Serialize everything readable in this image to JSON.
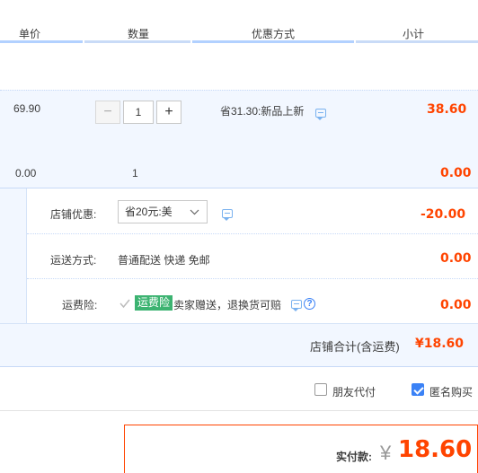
{
  "header": {
    "col_price": "单价",
    "col_quantity": "数量",
    "col_discount": "优惠方式",
    "col_subtotal": "小计"
  },
  "item": {
    "unit_price": "69.90",
    "quantity": "1",
    "discount_text": "省31.30:新品上新",
    "subtotal": "38.60",
    "decrement_symbol": "−",
    "increment_symbol": "+"
  },
  "extra_row": {
    "price": "0.00",
    "quantity": "1",
    "subtotal": "0.00"
  },
  "shop_discount": {
    "label": "店铺优惠:",
    "selected": "省20元:美",
    "amount": "-20.00"
  },
  "shipping": {
    "label": "运送方式:",
    "value": "普通配送 快递 免邮",
    "amount": "0.00"
  },
  "insurance": {
    "label": "运费险:",
    "badge": "运费险",
    "text": "卖家赠送，退换货可赔",
    "amount": "0.00",
    "help_symbol": "?"
  },
  "shop_total": {
    "label": "店铺合计(含运费)",
    "amount": "¥18.60"
  },
  "options": {
    "friend_pay": "朋友代付",
    "anonymous": "匿名购买"
  },
  "payment": {
    "label": "实付款:",
    "currency": "¥",
    "amount": "18.60"
  },
  "colors": {
    "accent_red": "#ff4400",
    "light_blue_bg": "#f2f7ff",
    "badge_green": "#3cb371",
    "checkbox_blue": "#3b82f6"
  },
  "icons": [
    "chat-icon",
    "minus-icon",
    "plus-icon",
    "chevron-down-icon",
    "help-icon",
    "checkbox-icon"
  ]
}
